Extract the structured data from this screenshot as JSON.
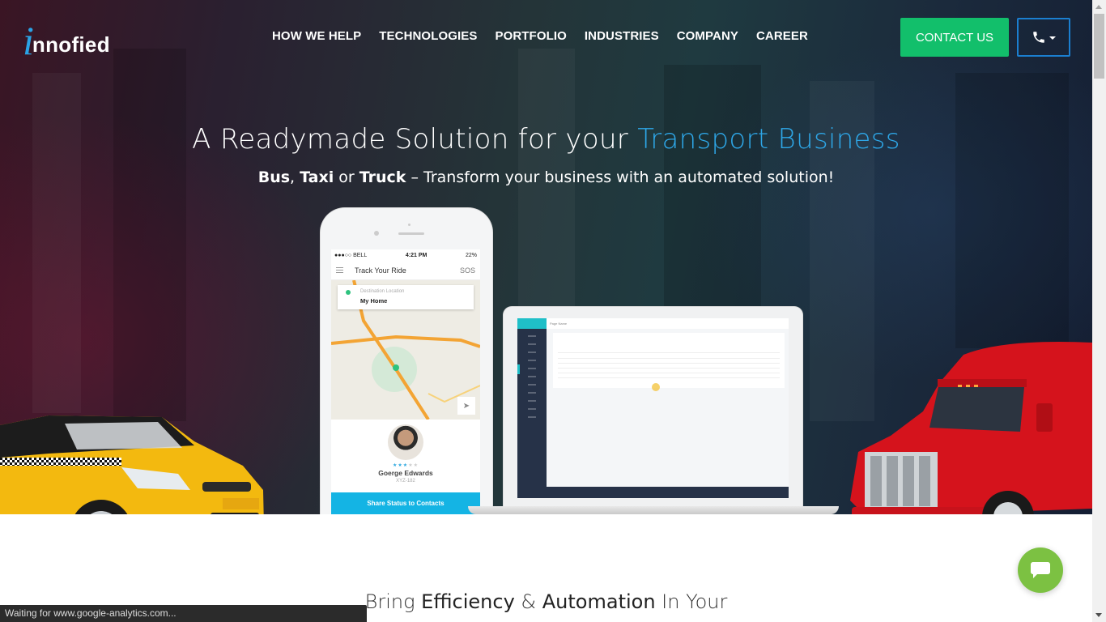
{
  "header": {
    "logo_i": "i",
    "logo_rest": "nnofied",
    "nav": [
      {
        "label": "HOW WE HELP"
      },
      {
        "label": "TECHNOLOGIES"
      },
      {
        "label": "PORTFOLIO"
      },
      {
        "label": "INDUSTRIES"
      },
      {
        "label": "COMPANY"
      },
      {
        "label": "CAREER"
      }
    ],
    "contact_label": "CONTACT US",
    "phone_icon": "phone-icon"
  },
  "hero": {
    "headline_plain": "A Readymade Solution for your ",
    "headline_highlight": "Transport Business",
    "sub_bus": "Bus",
    "sub_comma": ", ",
    "sub_taxi": "Taxi",
    "sub_or": " or ",
    "sub_truck": "Truck",
    "sub_rest": " – Transform your business with an automated solution!"
  },
  "phone_mockup": {
    "carrier": "●●●○○ BELL",
    "time": "4:21 PM",
    "battery": "22%",
    "app_title": "Track Your Ride",
    "sos": "SOS",
    "dest_label": "Destination Location",
    "dest_value": "My Home",
    "driver_name": "Goerge Edwards",
    "driver_plate": "XYZ-182",
    "rating": 3,
    "rating_max": 5,
    "share_label": "Share Status to Contacts"
  },
  "laptop_mockup": {
    "page_title": "Page Name"
  },
  "section2": {
    "pre": "Bring ",
    "b1": "Efficiency",
    "mid": " & ",
    "b2": "Automation",
    "post": " In Your"
  },
  "colors": {
    "accent_blue": "#2ea7e8",
    "contact_green": "#12bf6b",
    "chat_green": "#7cc142",
    "share_cyan": "#14b4e4"
  },
  "browser_status": "Waiting for www.google-analytics.com..."
}
